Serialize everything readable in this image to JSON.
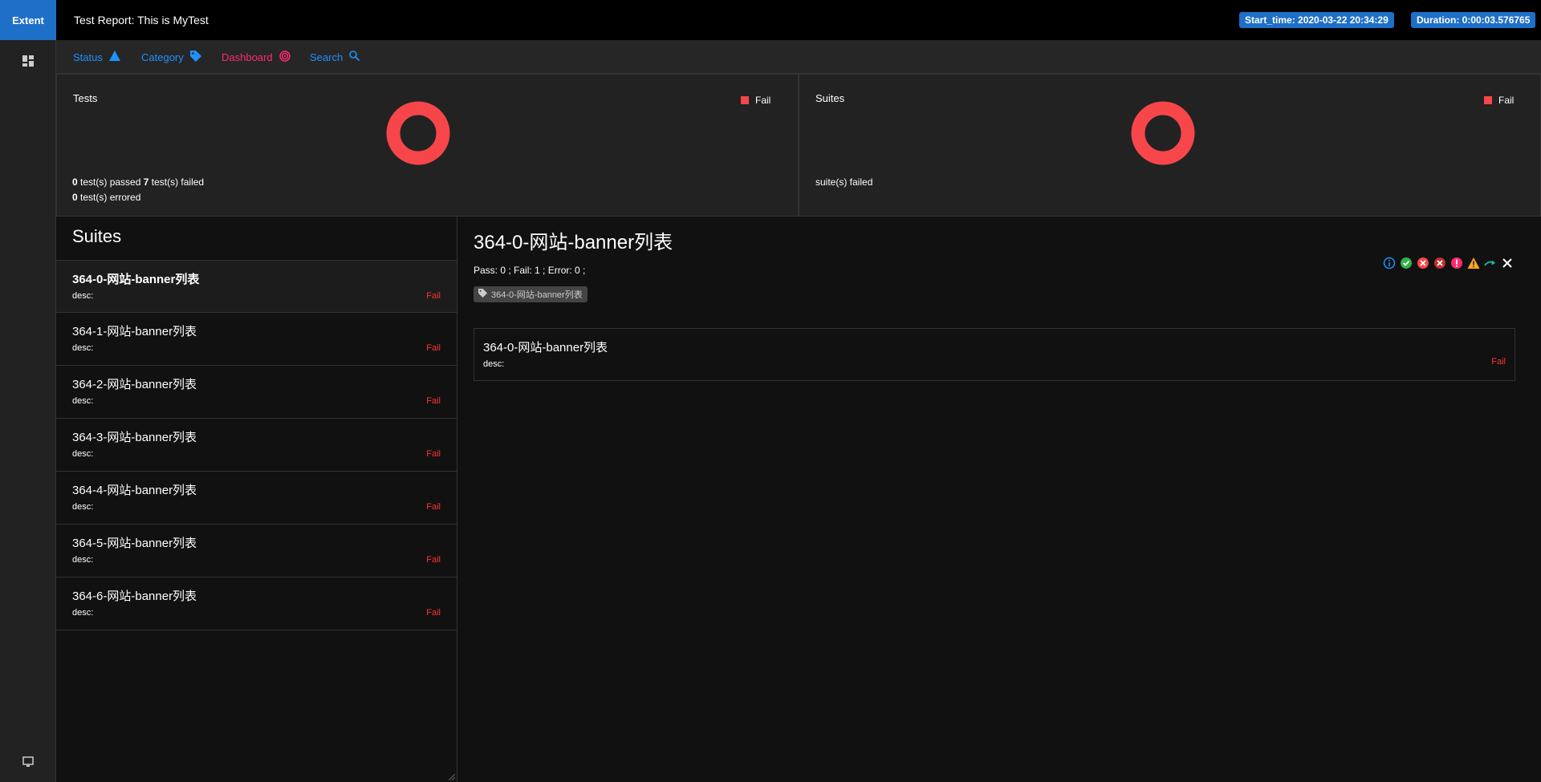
{
  "header": {
    "brand": "Extent",
    "title": "Test Report: This is MyTest",
    "start_time": "Start_time: 2020-03-22 20:34:29",
    "duration": "Duration: 0:00:03.576765"
  },
  "sidebar": {
    "icons": [
      "dashboard-icon",
      "monitor-icon"
    ]
  },
  "nav": {
    "items": [
      {
        "label": "Status",
        "icon": "warning-triangle-icon"
      },
      {
        "label": "Category",
        "icon": "tag-icon"
      },
      {
        "label": "Dashboard",
        "icon": "spiral-icon"
      },
      {
        "label": "Search",
        "icon": "search-icon"
      }
    ]
  },
  "charts": {
    "tests": {
      "title": "Tests",
      "legend": "Fail",
      "line1_prefix": "0",
      "line1_mid": " test(s) passed ",
      "line1_count": "7",
      "line1_suffix": " test(s) failed",
      "line2_count": "0",
      "line2_suffix": " test(s) errored"
    },
    "suites": {
      "title": "Suites",
      "legend": "Fail",
      "line1": "suite(s) failed"
    },
    "colors": {
      "fail": "#f7464a"
    }
  },
  "chart_data": [
    {
      "type": "pie",
      "title": "Tests",
      "categories": [
        "Fail"
      ],
      "values": [
        7
      ]
    },
    {
      "type": "pie",
      "title": "Suites",
      "categories": [
        "Fail"
      ],
      "values": [
        1
      ]
    }
  ],
  "suites": {
    "heading": "Suites",
    "items": [
      {
        "name": "364-0-网站-banner列表",
        "desc": "desc:",
        "status": "Fail"
      },
      {
        "name": "364-1-网站-banner列表",
        "desc": "desc:",
        "status": "Fail"
      },
      {
        "name": "364-2-网站-banner列表",
        "desc": "desc:",
        "status": "Fail"
      },
      {
        "name": "364-3-网站-banner列表",
        "desc": "desc:",
        "status": "Fail"
      },
      {
        "name": "364-4-网站-banner列表",
        "desc": "desc:",
        "status": "Fail"
      },
      {
        "name": "364-5-网站-banner列表",
        "desc": "desc:",
        "status": "Fail"
      },
      {
        "name": "364-6-网站-banner列表",
        "desc": "desc:",
        "status": "Fail"
      }
    ]
  },
  "detail": {
    "title": "364-0-网站-banner列表",
    "stats": "Pass: 0 ; Fail: 1 ; Error: 0 ;",
    "tag": "364-0-网站-banner列表",
    "filters": [
      "info-icon",
      "pass-icon",
      "fail-icon",
      "fatal-icon",
      "error-icon",
      "warning-icon",
      "skip-icon",
      "clear-filter-icon"
    ],
    "test": {
      "name": "364-0-网站-banner列表",
      "desc": "desc:",
      "status": "Fail"
    }
  }
}
